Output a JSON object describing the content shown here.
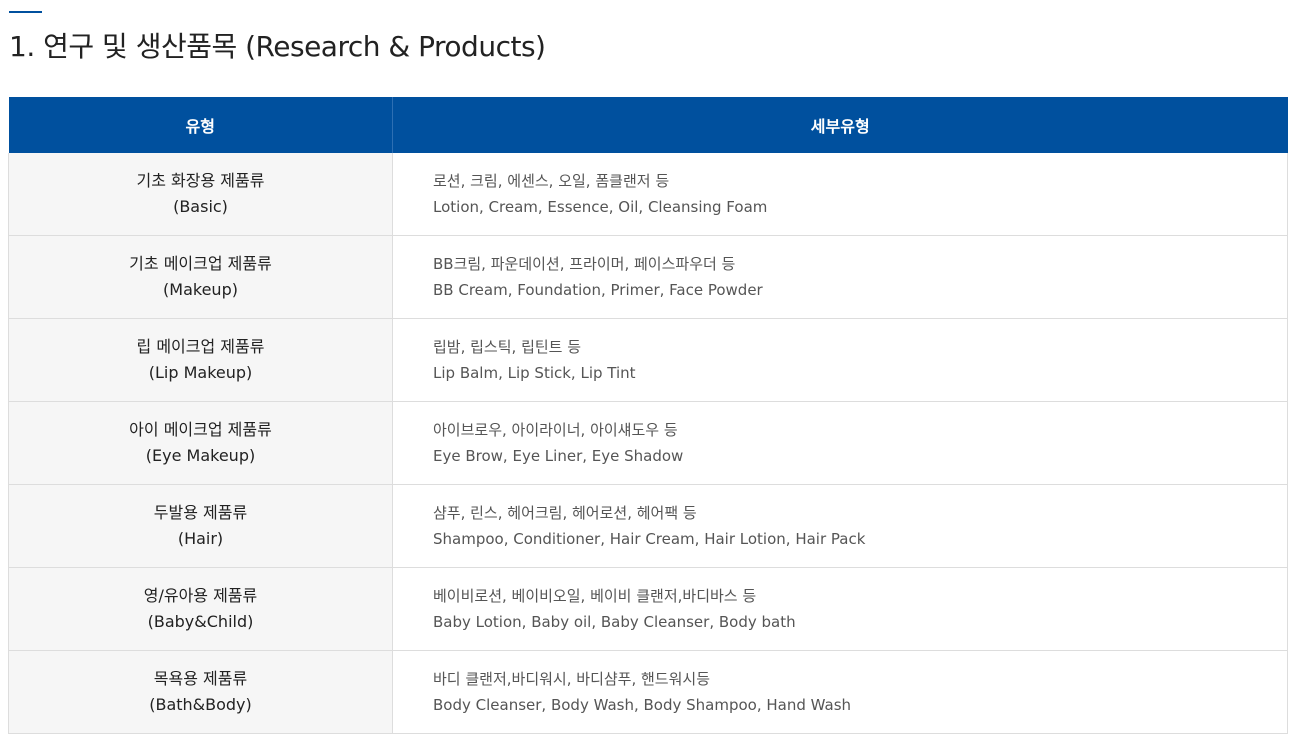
{
  "page": {
    "title": "1. 연구 및 생산품목 (Research & Products)"
  },
  "table": {
    "headers": [
      "유형",
      "세부유형"
    ],
    "rows": [
      {
        "type_ko": "기초 화장용 제품류",
        "type_en": "(Basic)",
        "detail_ko": "로션, 크림, 에센스, 오일, 폼클랜저 등",
        "detail_en": "Lotion, Cream, Essence, Oil, Cleansing Foam"
      },
      {
        "type_ko": "기초 메이크업 제품류",
        "type_en": "(Makeup)",
        "detail_ko": "BB크림, 파운데이션, 프라이머, 페이스파우더 등",
        "detail_en": "BB Cream, Foundation, Primer, Face Powder"
      },
      {
        "type_ko": "립 메이크업 제품류",
        "type_en": "(Lip Makeup)",
        "detail_ko": "립밤, 립스틱, 립틴트 등",
        "detail_en": "Lip Balm, Lip Stick, Lip Tint"
      },
      {
        "type_ko": "아이 메이크업 제품류",
        "type_en": "(Eye Makeup)",
        "detail_ko": "아이브로우, 아이라이너, 아이섀도우 등",
        "detail_en": "Eye Brow, Eye Liner, Eye Shadow"
      },
      {
        "type_ko": "두발용 제품류",
        "type_en": "(Hair)",
        "detail_ko": "샴푸, 린스, 헤어크림, 헤어로션, 헤어팩 등",
        "detail_en": "Shampoo, Conditioner, Hair Cream, Hair Lotion, Hair Pack"
      },
      {
        "type_ko": "영/유아용 제품류",
        "type_en": "(Baby&Child)",
        "detail_ko": "베이비로션, 베이비오일, 베이비 클랜저,바디바스 등",
        "detail_en": "Baby Lotion, Baby oil, Baby Cleanser, Body bath"
      },
      {
        "type_ko": "목욕용 제품류",
        "type_en": "(Bath&Body)",
        "detail_ko": "바디 클랜저,바디워시, 바디샴푸, 핸드워시등",
        "detail_en": "Body Cleanser, Body Wash, Body Shampoo, Hand Wash"
      }
    ]
  },
  "colors": {
    "accent": "#00509e",
    "header_text": "#ffffff",
    "type_cell_bg": "#f6f6f6",
    "border": "#dddddd"
  }
}
